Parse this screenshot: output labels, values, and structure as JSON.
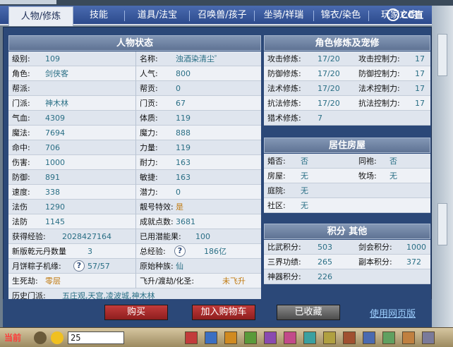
{
  "tabs": [
    {
      "label": "人物/修炼",
      "active": true
    },
    {
      "label": "技能"
    },
    {
      "label": "道具/法宝"
    },
    {
      "label": "召唤兽/孩子"
    },
    {
      "label": "坐骑/祥瑞"
    },
    {
      "label": "锦衣/染色"
    },
    {
      "label": "玩家之家"
    }
  ],
  "logo_text": "CC直播",
  "status": {
    "title": "人物状态",
    "left": [
      {
        "label": "级别:",
        "value": "109"
      },
      {
        "label": "角色:",
        "value": "剑侠客"
      },
      {
        "label": "帮派:",
        "value": ""
      },
      {
        "label": "门派:",
        "value": "神木林"
      },
      {
        "label": "气血:",
        "value": "4309"
      },
      {
        "label": "魔法:",
        "value": "7694"
      },
      {
        "label": "命中:",
        "value": "706"
      },
      {
        "label": "伤害:",
        "value": "1000"
      },
      {
        "label": "防御:",
        "value": "891"
      },
      {
        "label": "速度:",
        "value": "338"
      },
      {
        "label": "法伤",
        "value": "1290"
      },
      {
        "label": "法防",
        "value": "1145"
      },
      {
        "label": "获得经验:",
        "value": "2028427164"
      },
      {
        "label": "新版乾元丹数量",
        "value": "3"
      },
      {
        "label": "月饼粽子机缘:",
        "value": "57/57",
        "icon": "?"
      },
      {
        "label": "生死劫:",
        "value": "零层"
      }
    ],
    "right": [
      {
        "label": "名称:",
        "value": "浊酒染清尘゜"
      },
      {
        "label": "人气:",
        "value": "800"
      },
      {
        "label": "帮贡:",
        "value": "0"
      },
      {
        "label": "门贡:",
        "value": "67"
      },
      {
        "label": "体质:",
        "value": "119"
      },
      {
        "label": "魔力:",
        "value": "888"
      },
      {
        "label": "力量:",
        "value": "119"
      },
      {
        "label": "耐力:",
        "value": "163"
      },
      {
        "label": "敏捷:",
        "value": "163"
      },
      {
        "label": "潜力:",
        "value": "0"
      },
      {
        "label": "靓号特效:",
        "value": "是"
      },
      {
        "label": "成就点数:",
        "value": "3681"
      },
      {
        "label": "已用潜能果:",
        "value": "100"
      },
      {
        "label": "总经验:",
        "value": "186亿",
        "icon": "?"
      },
      {
        "label": "原始种族:",
        "value": "仙"
      },
      {
        "label": "飞升/渡劫/化圣:",
        "value": "未飞升"
      }
    ],
    "history_label": "历史门派:",
    "history_value": "五庄观,天宫,凌波城,神木林"
  },
  "cultivation": {
    "title": "角色修炼及宠修",
    "rows": [
      {
        "l1": "攻击修炼:",
        "v1": "17/20",
        "l2": "攻击控制力:",
        "v2": "17"
      },
      {
        "l1": "防御修炼:",
        "v1": "17/20",
        "l2": "防御控制力:",
        "v2": "17"
      },
      {
        "l1": "法术修炼:",
        "v1": "17/20",
        "l2": "法术控制力:",
        "v2": "17"
      },
      {
        "l1": "抗法修炼:",
        "v1": "17/20",
        "l2": "抗法控制力:",
        "v2": "17"
      },
      {
        "l1": "猎术修炼:",
        "v1": "7",
        "l2": "",
        "v2": ""
      }
    ]
  },
  "housing": {
    "title": "居住房屋",
    "rows": [
      {
        "l1": "婚否:",
        "v1": "否",
        "l2": "同袍:",
        "v2": "否"
      },
      {
        "l1": "房屋:",
        "v1": "无",
        "l2": "牧场:",
        "v2": "无"
      },
      {
        "l1": "庭院:",
        "v1": "无",
        "l2": "",
        "v2": ""
      },
      {
        "l1": "社区:",
        "v1": "无",
        "l2": "",
        "v2": ""
      }
    ]
  },
  "points": {
    "title": "积分 其他",
    "rows": [
      {
        "l1": "比武积分:",
        "v1": "503",
        "l2": "剑会积分:",
        "v2": "1000"
      },
      {
        "l1": "三界功绩:",
        "v1": "265",
        "l2": "副本积分:",
        "v2": "372"
      },
      {
        "l1": "神器积分:",
        "v1": "226",
        "l2": "",
        "v2": ""
      }
    ]
  },
  "buttons": {
    "buy": "购买",
    "add_cart": "加入购物车",
    "favorited": "已收藏",
    "web_version": "使用网页版"
  },
  "bottom_bar": {
    "current": "当前",
    "input_value": "25"
  },
  "colors": {
    "panel_bg": "#2b4878",
    "value_text": "#2a6f85",
    "highlight_value": "#c07a10",
    "red_button": "#a52a2a"
  }
}
